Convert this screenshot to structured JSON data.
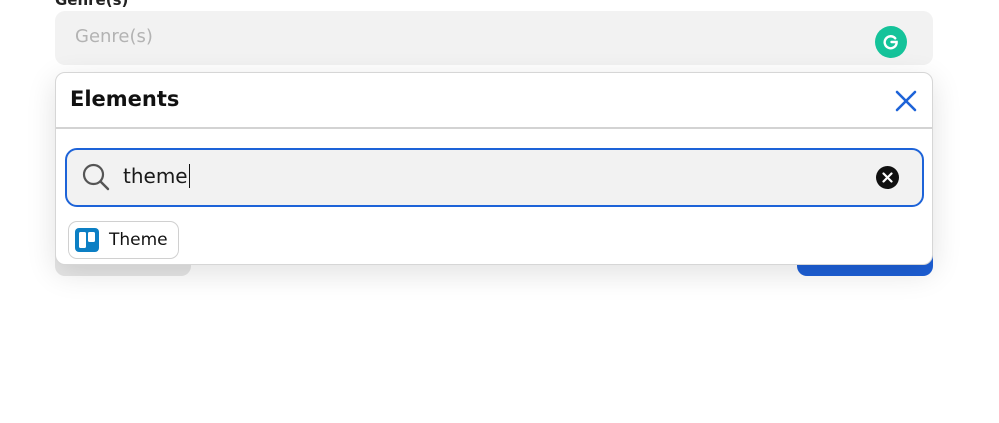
{
  "background_form": {
    "field_label": "Genre(s)",
    "genre_placeholder": "Genre(s)",
    "grammarly_icon": "grammarly-icon"
  },
  "popover": {
    "title": "Elements",
    "close_icon": "close-x-icon",
    "search": {
      "value": "theme",
      "icon": "search-icon",
      "clear_icon": "clear-circle-icon"
    },
    "results": [
      {
        "label": "Theme",
        "icon": "trello-icon"
      }
    ]
  },
  "colors": {
    "accent": "#1d63d8",
    "grammarly": "#15c39a",
    "trello": "#0c7fc4",
    "primary_button": "#1d5fd6"
  }
}
